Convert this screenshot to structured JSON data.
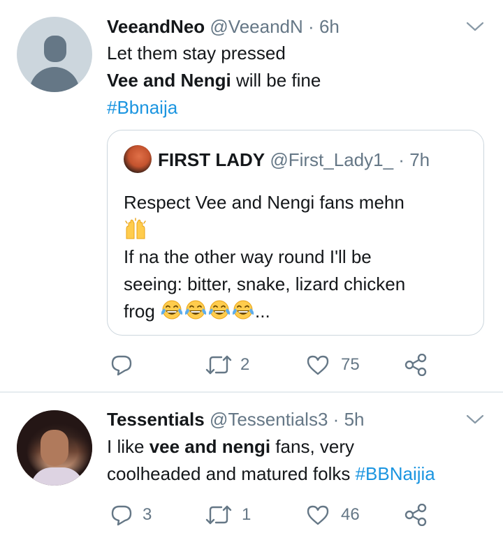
{
  "tweets": [
    {
      "name": "VeeandNeo",
      "handle": "@VeeandN",
      "sep": "·",
      "time": "6h",
      "avatar_icon": "default-profile-icon",
      "line1": "Let them stay pressed",
      "line2_bold": "Vee and Nengi",
      "line2_rest": " will be fine",
      "hashtag": "#Bbnaija",
      "quote": {
        "name": "FIRST LADY",
        "handle": "@First_Lady1_",
        "sep": "·",
        "time": "7h",
        "line1": "Respect Vee and Nengi fans mehn",
        "emoji_1": "raising-hands-emoji",
        "line2": "If na the other way round I'll be",
        "line3": "seeing: bitter, snake, lizard chicken",
        "line4_start": "frog ",
        "emoji_2": "tears-of-joy-emoji",
        "ellipsis": "..."
      },
      "reply_count": "",
      "retweet_count": "2",
      "like_count": "75"
    },
    {
      "name": "Tessentials",
      "handle": "@Tessentials3",
      "sep": "·",
      "time": "5h",
      "line1_start": "I like ",
      "line1_bold": "vee and nengi",
      "line1_end": " fans, very",
      "line2_text": "coolheaded and matured folks ",
      "hashtag": "#BBNaijia",
      "reply_count": "3",
      "retweet_count": "1",
      "like_count": "46"
    }
  ],
  "colors": {
    "text": "#14171a",
    "secondary": "#657786",
    "link": "#1b95e0",
    "border": "#ccd6dd",
    "divider": "#e6ecf0"
  }
}
